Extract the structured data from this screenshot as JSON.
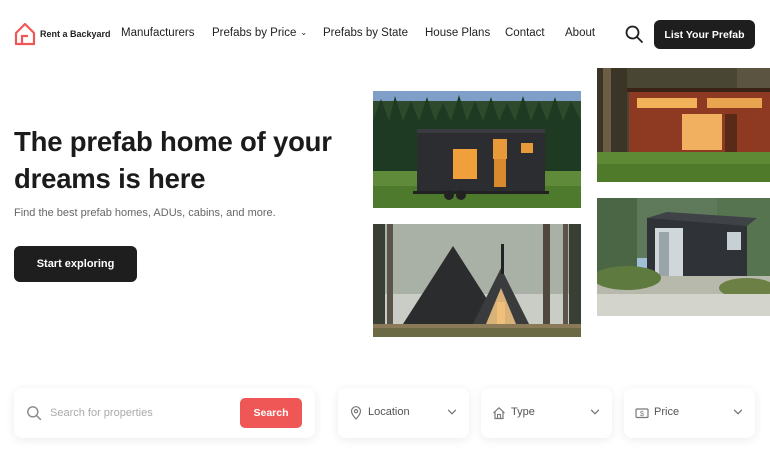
{
  "brand": {
    "name": "Rent a Backyard",
    "accent": "#ef5757",
    "dark": "#1e1e1e"
  },
  "nav": {
    "items": [
      {
        "label": "Manufacturers",
        "dropdown": false
      },
      {
        "label": "Prefabs by Price",
        "dropdown": true
      },
      {
        "label": "Prefabs by State",
        "dropdown": false
      },
      {
        "label": "House Plans",
        "dropdown": false
      },
      {
        "label": "Contact",
        "dropdown": false
      },
      {
        "label": "About",
        "dropdown": false
      }
    ],
    "search_icon": "search-icon",
    "cta_label": "List Your Prefab"
  },
  "hero": {
    "title": "The prefab home of your dreams is here",
    "subtitle": "Find the best prefab homes, ADUs, cabins, and more.",
    "cta_label": "Start exploring"
  },
  "search": {
    "placeholder": "Search for properties",
    "button_label": "Search",
    "filters": [
      {
        "label": "Location",
        "icon": "map-pin-icon"
      },
      {
        "label": "Type",
        "icon": "home-icon"
      },
      {
        "label": "Price",
        "icon": "dollar-icon"
      }
    ]
  }
}
